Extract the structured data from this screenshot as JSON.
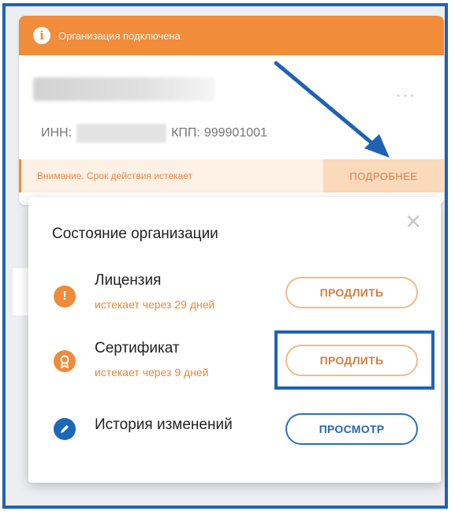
{
  "banner": {
    "text": "Организация подключена",
    "icon": "info-icon"
  },
  "card": {
    "inn_label": "ИНН:",
    "kpp_label": "КПП:",
    "kpp_value": "999901001",
    "more_icon": "ellipsis-icon",
    "warning": "Внимание. Срок действия истекает",
    "details_label": "ПОДРОБНЕЕ"
  },
  "popup": {
    "title": "Состояние организации",
    "close_icon": "close-icon",
    "items": [
      {
        "name": "Лицензия",
        "sub": "истекает через 29 дней",
        "button": "ПРОДЛИТЬ",
        "icon": "exclamation-icon",
        "icon_color": "#f08a3c"
      },
      {
        "name": "Сертификат",
        "sub": "истекает через 9 дней",
        "button": "ПРОДЛИТЬ",
        "icon": "certificate-icon",
        "icon_color": "#f08a3c"
      },
      {
        "name": "История изменений",
        "sub": "",
        "button": "ПРОСМОТР",
        "icon": "pencil-icon",
        "icon_color": "#1d67b8"
      }
    ]
  },
  "colors": {
    "accent_orange": "#f18c3a",
    "annotation_blue": "#1f62b4"
  }
}
